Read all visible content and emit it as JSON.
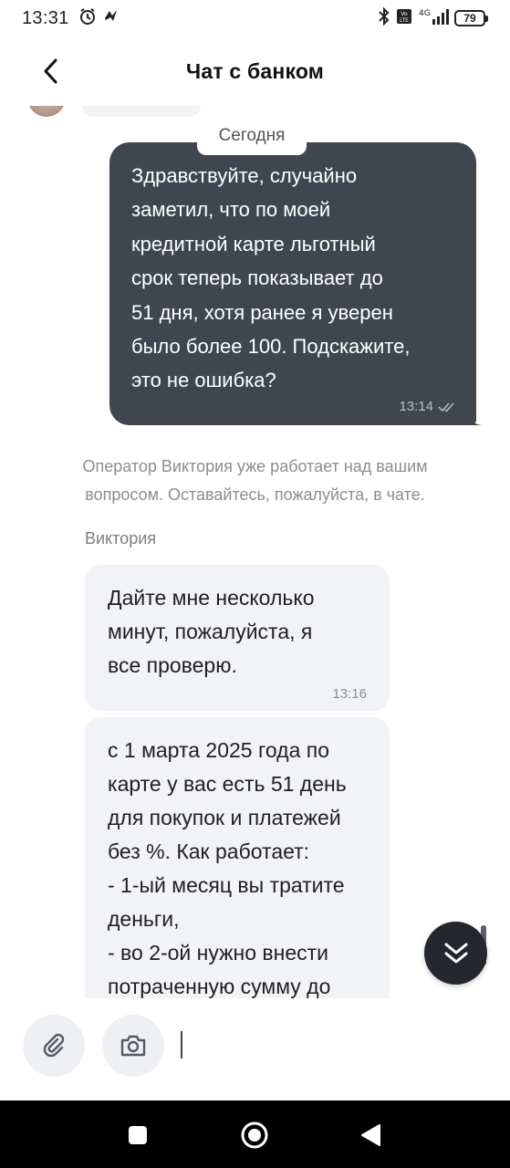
{
  "status_bar": {
    "time": "13:31",
    "battery": "79",
    "network": "4G"
  },
  "header": {
    "title": "Чат с банком"
  },
  "chat": {
    "date_separator": "Сегодня",
    "outgoing_message": {
      "text": "Здравствуйте, случайно\nзаметил, что по моей\nкредитной карте льготный\nсрок теперь показывает до\n51 дня, хотя ранее я уверен\nбыло более 100. Подскажите,\nэто не ошибка?",
      "time": "13:14",
      "status": "read"
    },
    "system_note": "Оператор Виктория уже работает над вашим\nвопросом. Оставайтесь, пожалуйста, в чате.",
    "operator_name": "Виктория",
    "incoming_messages": [
      {
        "text": "Дайте мне несколько\nминут, пожалуйста, я\nвсе проверю.",
        "time": "13:16"
      },
      {
        "text": "с 1 марта 2025 года по\nкарте у вас есть 51 день\nдля покупок и платежей\nбез %. Как работает:\n- 1-ый месяц вы тратите\nденьги,\n- во 2-ой нужно внести\nпотраченную сумму до",
        "time": ""
      }
    ]
  },
  "icons": {
    "back": "chevron-left-icon",
    "scroll_down": "double-chevron-down-icon",
    "attach": "paperclip-icon",
    "camera": "camera-icon"
  },
  "colors": {
    "outgoing_bubble": "#404650",
    "incoming_bubble": "#f2f3f6",
    "scroll_button": "#24272d"
  }
}
